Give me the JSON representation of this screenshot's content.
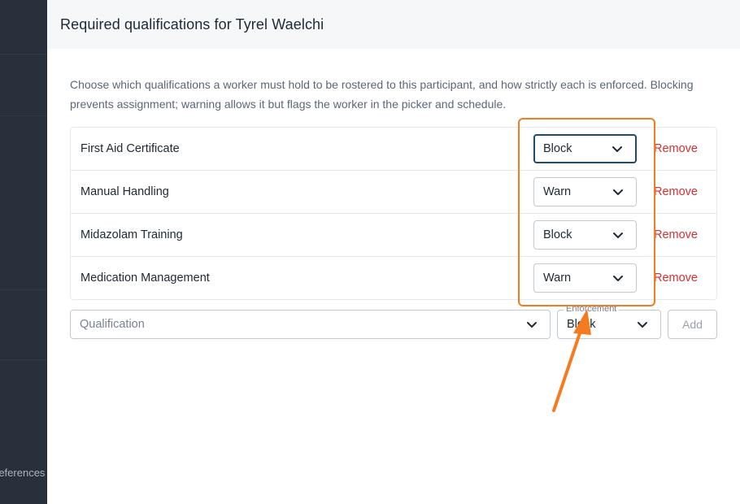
{
  "backdrop": {
    "sidebar_text": "references"
  },
  "panel": {
    "title": "Required qualifications for Tyrel Waelchi",
    "description": "Choose which qualifications a worker must hold to be rostered to this participant, and how strictly each is enforced. Blocking prevents assignment; warning allows it but flags the worker in the picker and schedule."
  },
  "qualifications": [
    {
      "name": "First Aid Certificate",
      "enforcement": "Block",
      "remove_label": "Remove"
    },
    {
      "name": "Manual Handling",
      "enforcement": "Warn",
      "remove_label": "Remove"
    },
    {
      "name": "Midazolam Training",
      "enforcement": "Block",
      "remove_label": "Remove"
    },
    {
      "name": "Medication Management",
      "enforcement": "Warn",
      "remove_label": "Remove"
    }
  ],
  "add_form": {
    "qualification_placeholder": "Qualification",
    "enforcement_label": "Enforcement",
    "enforcement_value": "Block",
    "add_label": "Add"
  },
  "annotation": {
    "color": "#f47b20"
  }
}
